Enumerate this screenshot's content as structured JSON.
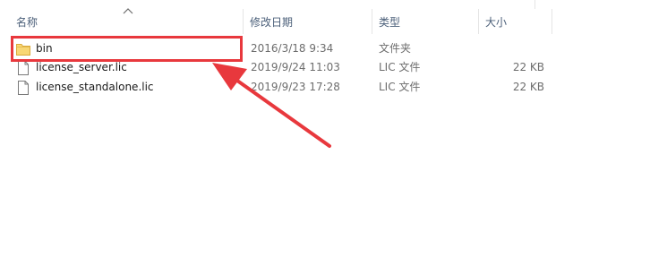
{
  "header": {
    "columns": {
      "name": "名称",
      "date_modified": "修改日期",
      "type": "类型",
      "size": "大小"
    }
  },
  "files": [
    {
      "name": "bin",
      "date": "2016/3/18 9:34",
      "type": "文件夹",
      "size": "",
      "icon": "folder-icon"
    },
    {
      "name": "license_server.lic",
      "date": "2019/9/24 11:03",
      "type": "LIC 文件",
      "size": "22 KB",
      "icon": "file-icon"
    },
    {
      "name": "license_standalone.lic",
      "date": "2019/9/23 17:28",
      "type": "LIC 文件",
      "size": "22 KB",
      "icon": "file-icon"
    }
  ],
  "annotation": {
    "color": "#e8383d"
  }
}
